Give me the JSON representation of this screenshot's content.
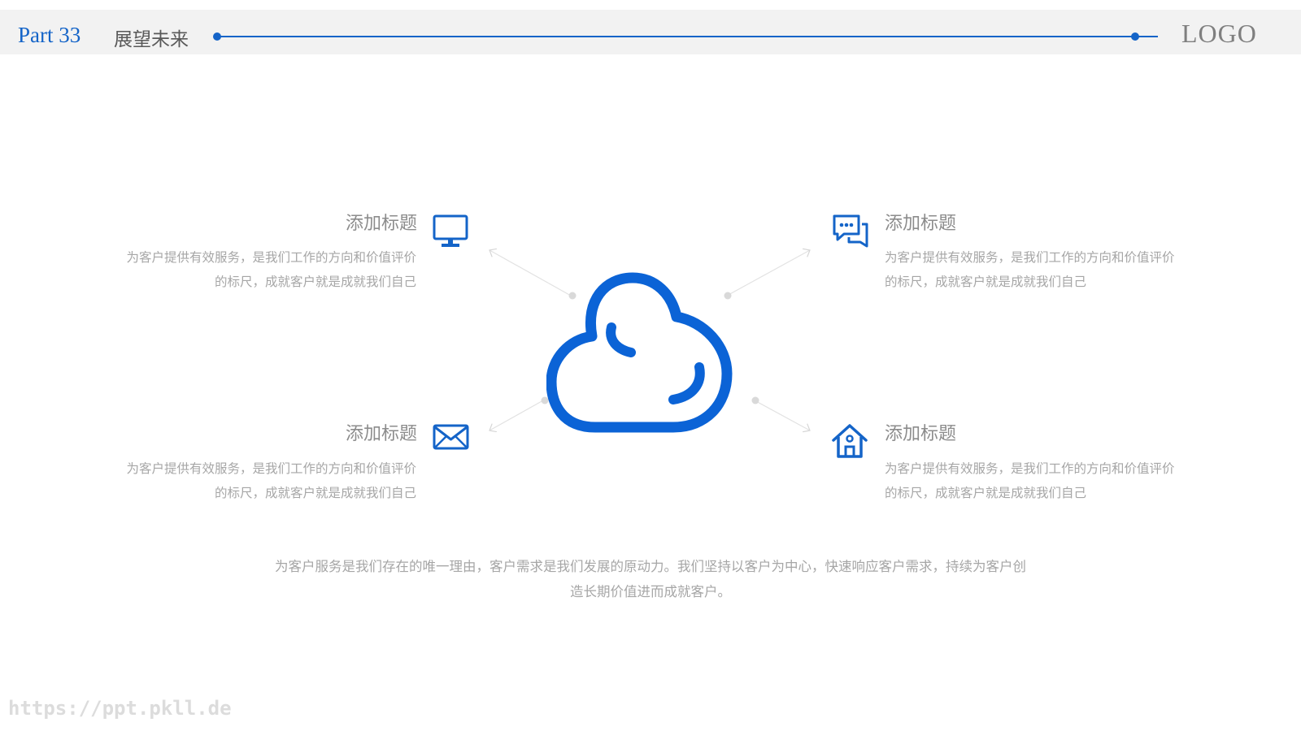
{
  "header": {
    "part_label": "Part  33",
    "title": "展望未来",
    "logo": "LOGO"
  },
  "items": [
    {
      "title": "添加标题",
      "text": "为客户提供有效服务，是我们工作的方向和价值评价的标尺，成就客户就是成就我们自己",
      "icon": "monitor-icon"
    },
    {
      "title": "添加标题",
      "text": "为客户提供有效服务，是我们工作的方向和价值评价的标尺，成就客户就是成就我们自己",
      "icon": "chat-icon"
    },
    {
      "title": "添加标题",
      "text": "为客户提供有效服务，是我们工作的方向和价值评价的标尺，成就客户就是成就我们自己",
      "icon": "mail-icon"
    },
    {
      "title": "添加标题",
      "text": "为客户提供有效服务，是我们工作的方向和价值评价的标尺，成就客户就是成就我们自己",
      "icon": "home-icon"
    }
  ],
  "footer": {
    "text": "为客户服务是我们存在的唯一理由，客户需求是我们发展的原动力。我们坚持以客户为中心，快速响应客户需求，持续为客户创造长期价值进而成就客户。"
  },
  "watermark": "https://ppt.pkll.de",
  "colors": {
    "accent": "#1464c8",
    "cloud": "#0b63d6",
    "text": "#a6a6a6"
  },
  "center_icon": "cloud-icon"
}
